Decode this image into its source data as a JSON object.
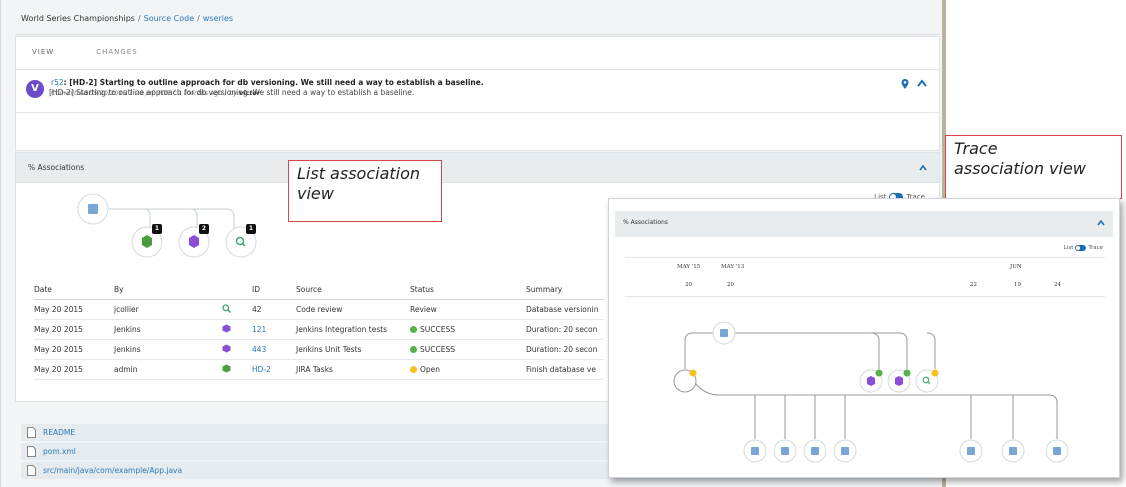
{
  "breadcrumb": {
    "root": "World Series Championships",
    "source": "Source Code",
    "repo": "wseries"
  },
  "tabs": [
    "VIEW",
    "CHANGES"
  ],
  "commit": {
    "avatar_letter": "V",
    "rev": "r52",
    "title": ": [HD-2] Starting to outline approach for db versioning. We still need a way to establish a baseline.",
    "meta_prefix": "Committed 05/20/2015 1:20 pm PDT ( 2 months ago ) by ",
    "author": "victor",
    "message": "[HD-2] Starting to outline approach for db versioning. We still need a way to establish a baseline."
  },
  "associations": {
    "title": "Associations",
    "toggle_list": "List",
    "toggle_trace": "Trace",
    "badges": [
      "1",
      "2",
      "1"
    ],
    "columns": [
      "Date",
      "By",
      "",
      "ID",
      "Source",
      "Status",
      "Summary"
    ],
    "rows": [
      {
        "date": "May 20 2015",
        "by": "jcollier",
        "icon": "search-icon",
        "id": "42",
        "source": "Code review",
        "status": "Review",
        "summary": "Database versionin"
      },
      {
        "date": "May 20 2015",
        "by": "Jenkins",
        "icon": "cube-icon",
        "id": "121",
        "source": "Jenkins Integration tests",
        "status": "SUCCESS",
        "summary": "Duration: 20 secon"
      },
      {
        "date": "May 20 2015",
        "by": "Jenkins",
        "icon": "cube-icon",
        "id": "443",
        "source": "Jenkins Unit Tests",
        "status": "SUCCESS",
        "summary": "Duration: 20 secon"
      },
      {
        "date": "May 20 2015",
        "by": "admin",
        "icon": "jira-icon",
        "id": "HD-2",
        "source": "JIRA Tasks",
        "status": "Open",
        "summary": "Finish database ve"
      }
    ]
  },
  "files": [
    "README",
    "pom.xml",
    "src/main/java/com/example/App.java"
  ],
  "callouts": {
    "list_line1": "List association",
    "list_line2": "view",
    "trace_line1": "Trace",
    "trace_line2": "association view"
  },
  "inset": {
    "title": "Associations",
    "toggle_list": "List",
    "toggle_trace": "Trace",
    "months": [
      "MAY '15",
      "MAY '13",
      "JUN"
    ],
    "days": [
      "20",
      "20",
      "22",
      "19",
      "24"
    ]
  },
  "colors": {
    "link": "#2a7ab8",
    "avatar": "#6c4cc8",
    "success": "#58b04a",
    "open": "#f5c21a",
    "callout_border": "#d8454b",
    "toggle": "#1e6fb0"
  }
}
